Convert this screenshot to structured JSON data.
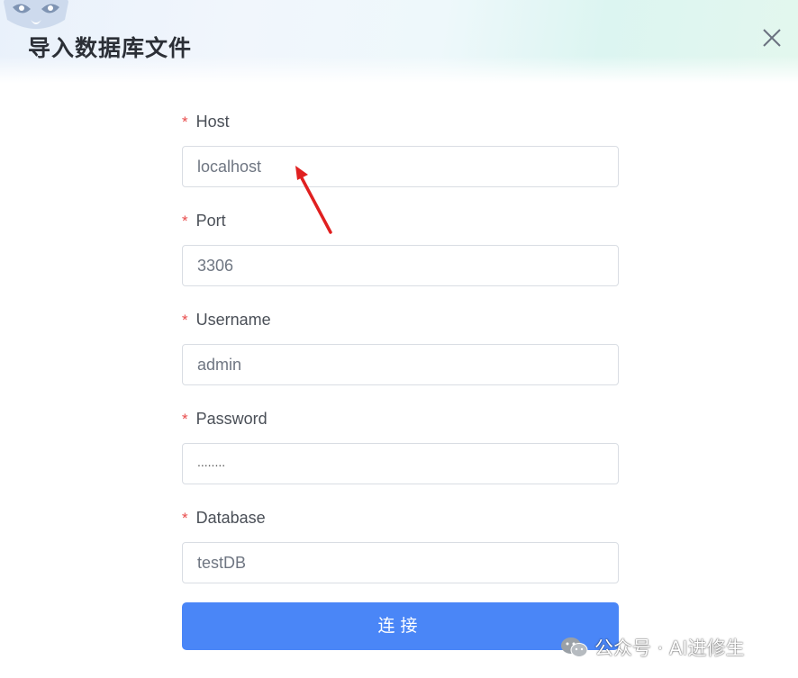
{
  "dialog": {
    "title": "导入数据库文件",
    "close_icon": "close-icon",
    "mascot_icon": "raccoon-mascot-icon"
  },
  "form": {
    "required_mark": "*",
    "fields": [
      {
        "label": "Host",
        "value": "localhost"
      },
      {
        "label": "Port",
        "value": "3306"
      },
      {
        "label": "Username",
        "value": "admin"
      },
      {
        "label": "Password",
        "value": "........"
      },
      {
        "label": "Database",
        "value": "testDB"
      }
    ],
    "connect_label": "连接"
  },
  "watermark": {
    "text": "公众号 · AI进修生",
    "icon": "wechat-icon"
  },
  "colors": {
    "primary": "#4a86f7",
    "required": "#e84a4a",
    "annotation_arrow": "#e02020"
  }
}
